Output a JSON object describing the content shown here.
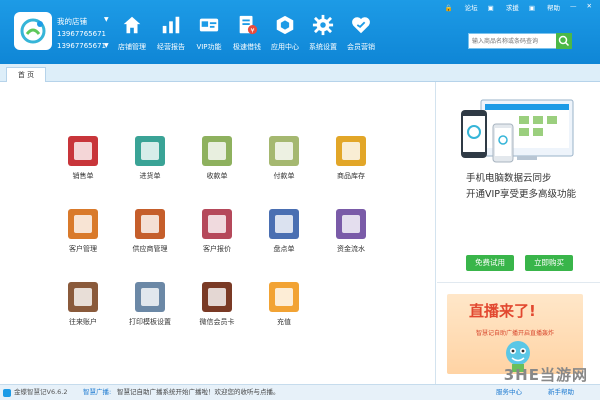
{
  "header": {
    "store_name": "我的店铺",
    "phone_line1": "13967765671",
    "phone_line2": "13967765671",
    "nav": [
      {
        "label": "店铺管理",
        "icon": "home-icon"
      },
      {
        "label": "经营报告",
        "icon": "bar-chart-icon"
      },
      {
        "label": "VIP功能",
        "icon": "vip-card-icon"
      },
      {
        "label": "极速借钱",
        "icon": "money-doc-icon"
      },
      {
        "label": "应用中心",
        "icon": "app-center-icon"
      },
      {
        "label": "系统设置",
        "icon": "gear-icon"
      },
      {
        "label": "会员营销",
        "icon": "heart-icon"
      }
    ],
    "topbar": {
      "forum": "论坛",
      "help_request": "求援",
      "help": "帮助"
    },
    "search": {
      "placeholder": "输入商品名称或条码查询"
    }
  },
  "tabs": [
    {
      "label": "首 页"
    }
  ],
  "main": {
    "tiles": [
      {
        "label": "销售单",
        "icon": "sales-order-icon",
        "color": "#c8353a"
      },
      {
        "label": "进货单",
        "icon": "purchase-order-icon",
        "color": "#3aa396"
      },
      {
        "label": "收款单",
        "icon": "receipt-icon",
        "color": "#8eb15e"
      },
      {
        "label": "付款单",
        "icon": "payment-icon",
        "color": "#a5b870"
      },
      {
        "label": "商品库存",
        "icon": "inventory-icon",
        "color": "#e2a628"
      },
      {
        "label": "客户管理",
        "icon": "customer-icon",
        "color": "#d97a2b"
      },
      {
        "label": "供应商管理",
        "icon": "supplier-icon",
        "color": "#c55e2b"
      },
      {
        "label": "客户报价",
        "icon": "quote-icon",
        "color": "#b5495b"
      },
      {
        "label": "盘点单",
        "icon": "stock-check-icon",
        "color": "#4a6fb2"
      },
      {
        "label": "资金流水",
        "icon": "cash-flow-icon",
        "color": "#7a5ba8"
      },
      {
        "label": "往来账户",
        "icon": "accounts-icon",
        "color": "#8a5a3b"
      },
      {
        "label": "打印模板设置",
        "icon": "printer-icon",
        "color": "#6b88a6"
      },
      {
        "label": "微信会员卡",
        "icon": "wechat-card-icon",
        "color": "#7a3a25"
      },
      {
        "label": "充值",
        "icon": "recharge-icon",
        "color": "#f2a334"
      }
    ]
  },
  "side": {
    "sync_line1": "手机电脑数据云同步",
    "sync_line2": "开通VIP享受更多高级功能",
    "free_trial": "免费试用",
    "buy_now": "立即购买",
    "banner_title": "直播来了!",
    "banner_sub": "智慧记自助广播开启直播轰炸",
    "watermark": "3HE当游网"
  },
  "statusbar": {
    "version": "金蝶智慧记V6.6.2",
    "msg_label": "智慧广播:",
    "message": "智慧记自助广播系统开始广播啦！欢迎您的收听与点播。",
    "right1": "服务中心",
    "right2": "新手帮助"
  }
}
